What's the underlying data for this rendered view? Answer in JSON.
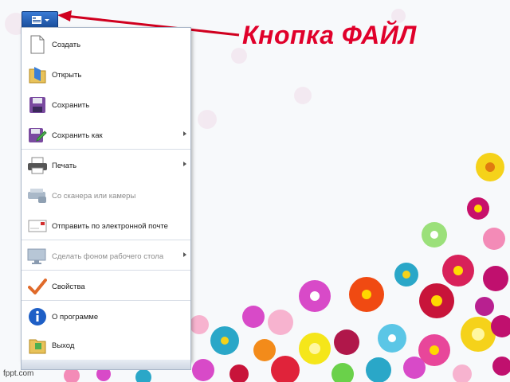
{
  "menu": {
    "items": [
      {
        "label": "Создать",
        "icon": "new-document-icon",
        "submenu": false,
        "disabled": false
      },
      {
        "label": "Открыть",
        "icon": "open-folder-icon",
        "submenu": false,
        "disabled": false
      },
      {
        "label": "Сохранить",
        "icon": "save-disk-icon",
        "submenu": false,
        "disabled": false
      },
      {
        "label": "Сохранить как",
        "icon": "save-as-icon",
        "submenu": true,
        "disabled": false
      },
      {
        "label": "Печать",
        "icon": "printer-icon",
        "submenu": true,
        "disabled": false
      },
      {
        "label": "Со сканера или камеры",
        "icon": "scanner-icon",
        "submenu": false,
        "disabled": true
      },
      {
        "label": "Отправить по электронной почте",
        "icon": "email-icon",
        "submenu": false,
        "disabled": false
      },
      {
        "label": "Сделать фоном рабочего стола",
        "icon": "desktop-background-icon",
        "submenu": true,
        "disabled": true
      },
      {
        "label": "Свойства",
        "icon": "checkmark-icon",
        "submenu": false,
        "disabled": false
      },
      {
        "label": "О программе",
        "icon": "info-icon",
        "submenu": false,
        "disabled": false
      },
      {
        "label": "Выход",
        "icon": "exit-icon",
        "submenu": false,
        "disabled": false
      }
    ]
  },
  "callout": {
    "text": "Кнопка ФАЙЛ",
    "color": "#e0002a"
  },
  "footer": {
    "brand": "fppt.com"
  }
}
